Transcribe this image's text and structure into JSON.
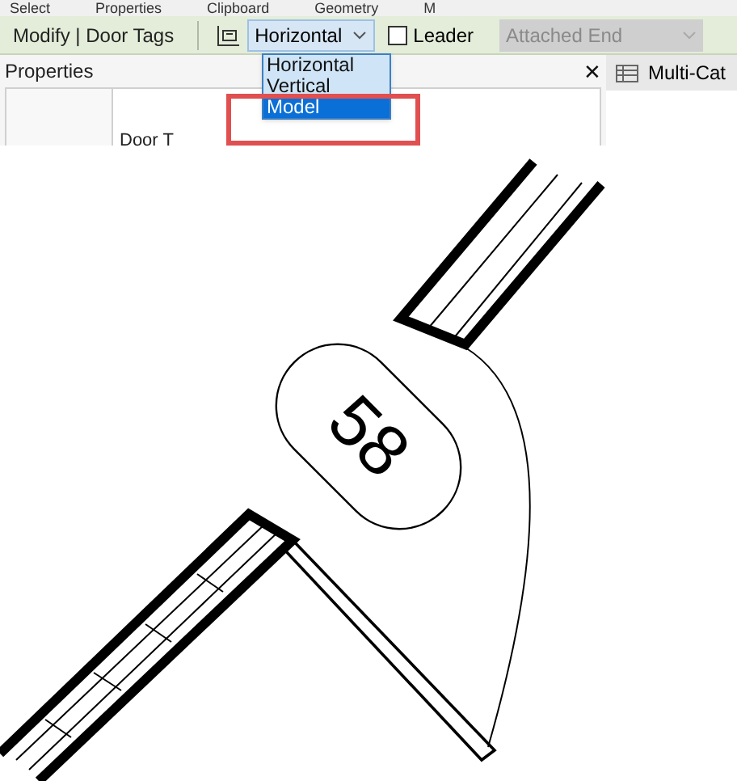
{
  "ribbon_panels": [
    "Select",
    "Properties",
    "Clipboard",
    "Geometry",
    "M"
  ],
  "options_bar": {
    "context": "Modify | Door Tags",
    "orientation": {
      "value": "Horizontal"
    },
    "leader": {
      "label": "Leader",
      "checked": false
    },
    "end": {
      "value": "Attached End",
      "disabled": true
    }
  },
  "orientation_list": [
    {
      "label": "Horizontal",
      "selected": false
    },
    {
      "label": "Vertical",
      "selected": false
    },
    {
      "label": "Model",
      "selected": true
    }
  ],
  "properties": {
    "title": "Properties",
    "close": "✕",
    "type_label": "Door T"
  },
  "view_tab": {
    "label": "Multi-Cat"
  },
  "tag": {
    "text": "58"
  }
}
